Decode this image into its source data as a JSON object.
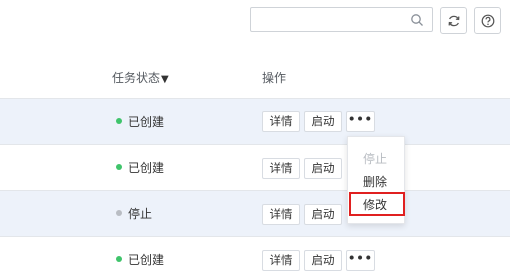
{
  "toolbar": {
    "search_placeholder": "",
    "search_icon": "search-icon",
    "refresh_icon": "refresh-icon",
    "help_icon": "help-icon"
  },
  "table": {
    "columns": {
      "status": "任务状态",
      "action": "操作"
    },
    "rows": [
      {
        "status": "已创建",
        "status_color": "#3fc46b"
      },
      {
        "status": "已创建",
        "status_color": "#3fc46b"
      },
      {
        "status": "停止",
        "status_color": "#b9bdc3"
      },
      {
        "status": "已创建",
        "status_color": "#3fc46b"
      }
    ],
    "actions": {
      "detail": "详情",
      "start": "启动",
      "more": "•••"
    }
  },
  "dropdown": {
    "items": [
      {
        "label": "停止",
        "disabled": true
      },
      {
        "label": "删除",
        "disabled": false
      },
      {
        "label": "修改",
        "disabled": false,
        "highlighted": true
      }
    ]
  },
  "colors": {
    "row_highlight": "#edf2fa",
    "annotation_box": "#e02020"
  }
}
